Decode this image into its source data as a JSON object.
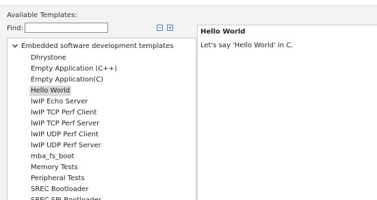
{
  "templates": {
    "section_label": "Available Templates:",
    "find_label": "Find:",
    "find_value": "",
    "toolbar_icons": [
      "collapse-all-icon",
      "expand-all-icon"
    ],
    "group": {
      "label": "Embedded software development templates",
      "expanded": true,
      "items": [
        {
          "label": "Dhrystone",
          "selected": false
        },
        {
          "label": "Empty Application (C++)",
          "selected": false
        },
        {
          "label": "Empty Application(C)",
          "selected": false
        },
        {
          "label": "Hello World",
          "selected": true
        },
        {
          "label": "lwIP Echo Server",
          "selected": false
        },
        {
          "label": "lwIP TCP Perf Client",
          "selected": false
        },
        {
          "label": "lwIP TCP Perf Server",
          "selected": false
        },
        {
          "label": "lwIP UDP Perf Client",
          "selected": false
        },
        {
          "label": "lwIP UDP Perf Server",
          "selected": false
        },
        {
          "label": "mba_fs_boot",
          "selected": false
        },
        {
          "label": "Memory Tests",
          "selected": false
        },
        {
          "label": "Peripheral Tests",
          "selected": false
        },
        {
          "label": "SREC Bootloader",
          "selected": false
        },
        {
          "label": "SREC SPI Bootloader",
          "selected": false
        }
      ]
    },
    "selection_color": "#d9d9d9"
  },
  "description": {
    "title": "Hello World",
    "text": "Let's say 'Hello World' in C."
  }
}
